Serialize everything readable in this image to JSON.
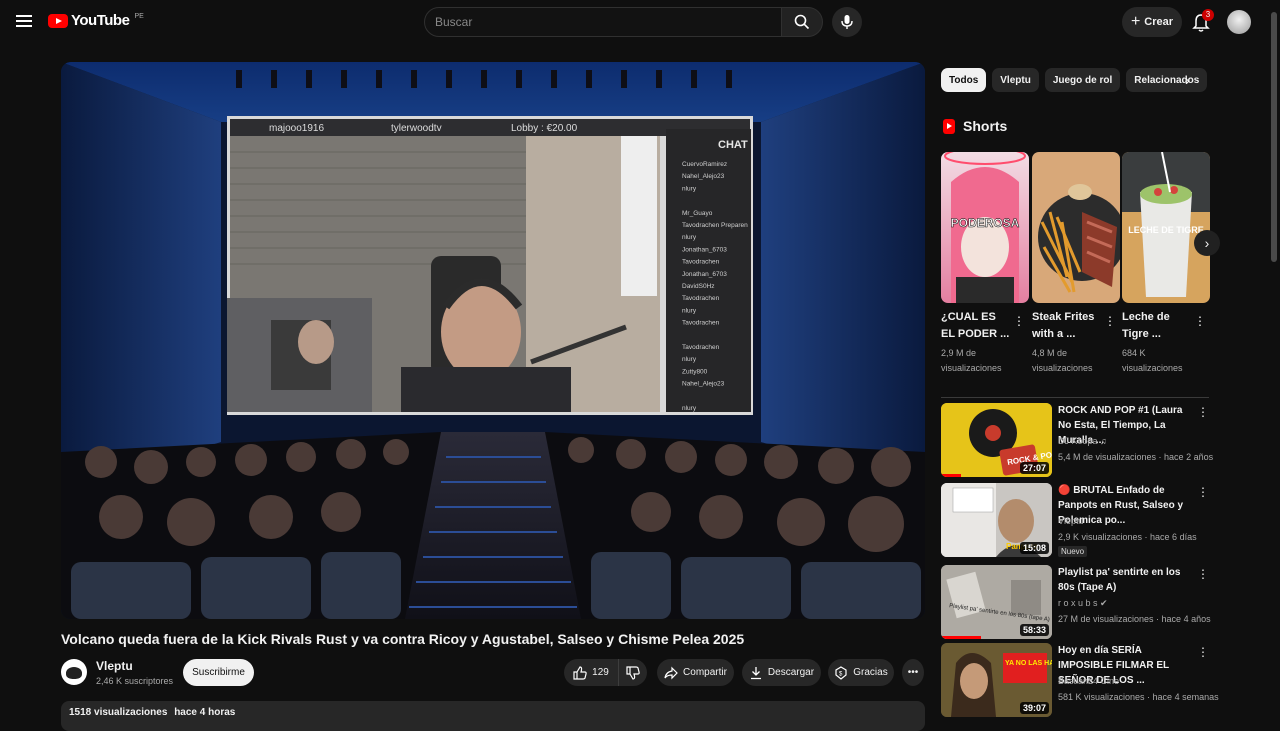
{
  "topbar": {
    "logo_text": "YouTube",
    "country_code": "PE",
    "search_placeholder": "Buscar",
    "create_label": "Crear",
    "notification_count": "3"
  },
  "player": {
    "overlay_texts": {
      "left_name": "majooo1916",
      "center_name": "tylerwoodtv",
      "lobby": "Lobby : €20.00",
      "chat_header": "CHAT"
    },
    "chat_names": [
      "CuervoRamirez",
      "Nahel_Alejo23",
      "nlury",
      "",
      "Mr_Guayo",
      "Tavodrachen Preparen",
      "nlury",
      "Jonathan_6703",
      "Tavodrachen",
      "Jonathan_6703",
      "DavidS0Hz",
      "Tavodrachen",
      "nlury",
      "Tavodrachen",
      "",
      "Tavodrachen",
      "nlury",
      "Zutty800",
      "Nahel_Alejo23",
      "",
      "nlury"
    ]
  },
  "video": {
    "title": "Volcano queda fuera de la Kick Rivals Rust y va contra Ricoy y Agustabel, Salseo y Chisme Pelea 2025",
    "channel_name": "Vleptu",
    "subscribers": "2,46 K suscriptores",
    "subscribe_label": "Suscribirme",
    "likes": "129",
    "share_label": "Compartir",
    "download_label": "Descargar",
    "thanks_label": "Gracias",
    "views": "1518 visualizaciones",
    "time_ago": "hace 4 horas"
  },
  "chips": [
    "Todos",
    "Vleptu",
    "Juego de rol",
    "Relacionados"
  ],
  "shorts": {
    "heading": "Shorts",
    "items": [
      {
        "title": "¿CUAL ES EL PODER ...",
        "views": "2,9 M de visualizaciones",
        "overlay": "PODEROSA"
      },
      {
        "title": "Steak Frites with a ...",
        "views": "4,8 M de visualizaciones",
        "overlay": ""
      },
      {
        "title": "Leche de Tigre ...",
        "views": "684 K visualizaciones",
        "overlay": "LECHE DE TIGRE"
      }
    ]
  },
  "recommendations": [
    {
      "title": "ROCK AND POP #1 (Laura No Esta, El Tiempo, La Muralla ...",
      "channel": "DJ Koopa ♫",
      "meta": "5,4 M de visualizaciones · hace 2 años",
      "duration": "27:07",
      "badge": "",
      "thumb_text": "ROCK & POP"
    },
    {
      "title": "🔴 BRUTAL Enfado de Panpots en Rust, Salseo y Polemica po...",
      "channel": "Vleptu",
      "meta": "2,9 K visualizaciones · hace 6 días",
      "duration": "15:08",
      "badge": "Nuevo",
      "thumb_text": "Panpots"
    },
    {
      "title": "Playlist pa' sentirte en los 80s (Tape A)",
      "channel": "r o x u b s ✔",
      "meta": "27 M de visualizaciones · hace 4 años",
      "duration": "58:33",
      "badge": "",
      "thumb_text": "Playlist pa' sentirte en los 80s (tape A)"
    },
    {
      "title": "Hoy en día SERÍA IMPOSIBLE FILMAR EL SEÑOR DE LOS ...",
      "channel": "Bastian24 Cine",
      "meta": "581 K visualizaciones · hace 4 semanas",
      "duration": "39:07",
      "badge": "",
      "thumb_text": "YA NO LAS HACEN ASÍ"
    }
  ]
}
